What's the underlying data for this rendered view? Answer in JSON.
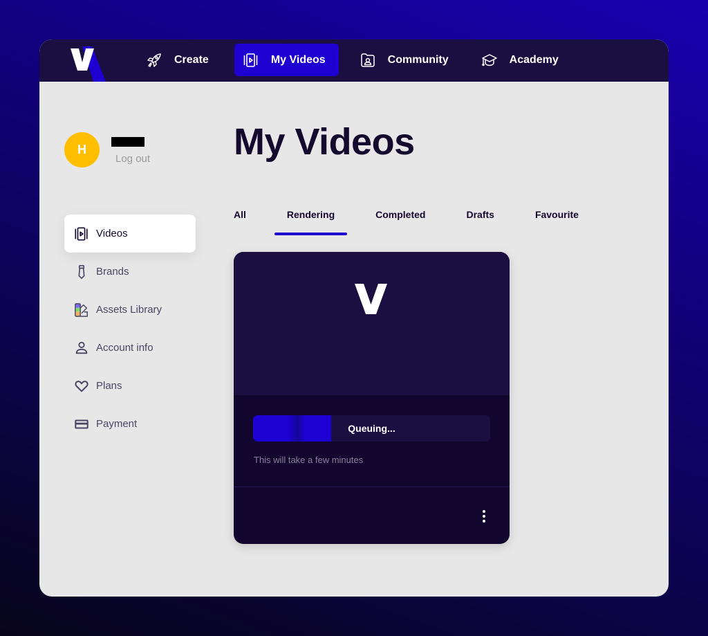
{
  "topbar": {
    "logo_letter": "V",
    "nav": [
      {
        "label": "Create",
        "icon": "rocket-icon",
        "active": false
      },
      {
        "label": "My Videos",
        "icon": "video-frame-icon",
        "active": true
      },
      {
        "label": "Community",
        "icon": "folder-user-icon",
        "active": false
      },
      {
        "label": "Academy",
        "icon": "graduation-cap-icon",
        "active": false
      }
    ]
  },
  "profile": {
    "avatar_initial": "H",
    "name": "",
    "logout_label": "Log out"
  },
  "sidebar": {
    "items": [
      {
        "label": "Videos",
        "icon": "video-frame-icon",
        "active": true
      },
      {
        "label": "Brands",
        "icon": "tie-icon",
        "active": false
      },
      {
        "label": "Assets Library",
        "icon": "color-palette-icon",
        "active": false
      },
      {
        "label": "Account info",
        "icon": "user-icon",
        "active": false
      },
      {
        "label": "Plans",
        "icon": "heart-icon",
        "active": false
      },
      {
        "label": "Payment",
        "icon": "credit-card-icon",
        "active": false
      }
    ]
  },
  "main": {
    "title": "My Videos",
    "tabs": [
      {
        "label": "All",
        "active": false
      },
      {
        "label": "Rendering",
        "active": true
      },
      {
        "label": "Completed",
        "active": false
      },
      {
        "label": "Drafts",
        "active": false
      },
      {
        "label": "Favourite",
        "active": false
      }
    ],
    "video_card": {
      "thumbnail_letter": "V",
      "status_label": "Queuing...",
      "progress_percent": 33,
      "eta_text": "This will take a few minutes",
      "more_icon": "more-vertical-icon"
    }
  },
  "colors": {
    "accent": "#1e00d1",
    "topbar_bg": "#1a0f40",
    "avatar": "#ffbf00",
    "panel_bg": "#e7e7e7",
    "card_bg": "#12062e"
  }
}
